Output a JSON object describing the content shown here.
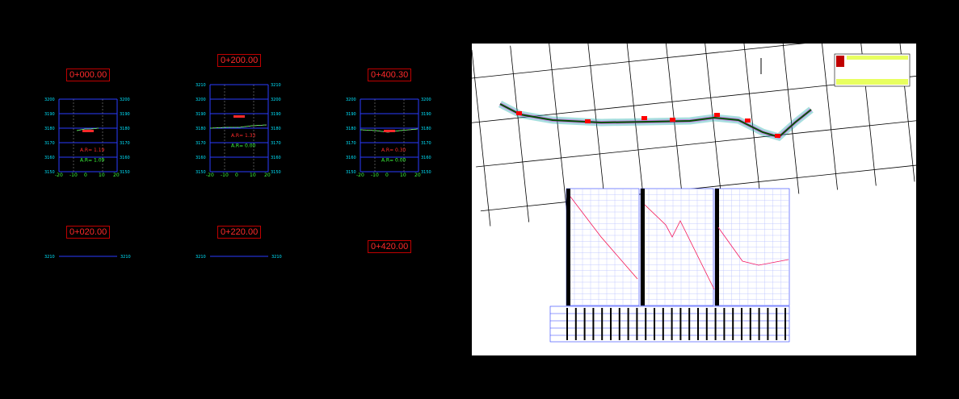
{
  "sections": [
    {
      "station": "0+000.00",
      "ar_label": "A.R=",
      "ar_value": "1.19",
      "ar2_value": "1.09"
    },
    {
      "station": "0+200.00",
      "ar_label": "A.R=",
      "ar_value": "1.33",
      "ar2_value": "0.00"
    },
    {
      "station": "0+400.30",
      "ar_label": "A.R=",
      "ar_value": "0.30",
      "ar2_value": "0.00"
    },
    {
      "station": "0+020.00"
    },
    {
      "station": "0+220.00"
    },
    {
      "station": "0+420.00"
    }
  ],
  "y_ticks": [
    "3200",
    "3190",
    "3180",
    "3170",
    "3160",
    "3150"
  ],
  "y_ticks_b": [
    "3210",
    "3200",
    "3190",
    "3180",
    "3170",
    "3160",
    "3150"
  ],
  "x_ticks": [
    "-20",
    "-10",
    "0",
    "10",
    "20"
  ],
  "top_row_tick": "3210",
  "colors": {
    "background": "#000000",
    "grid_blue": "#2a3cff",
    "tick_cyan": "#00e5ff",
    "station_red": "#ff2a2a",
    "ground_green": "#3cff3c",
    "sheet_bg": "#ffffff",
    "magenta": "#e020e0"
  }
}
